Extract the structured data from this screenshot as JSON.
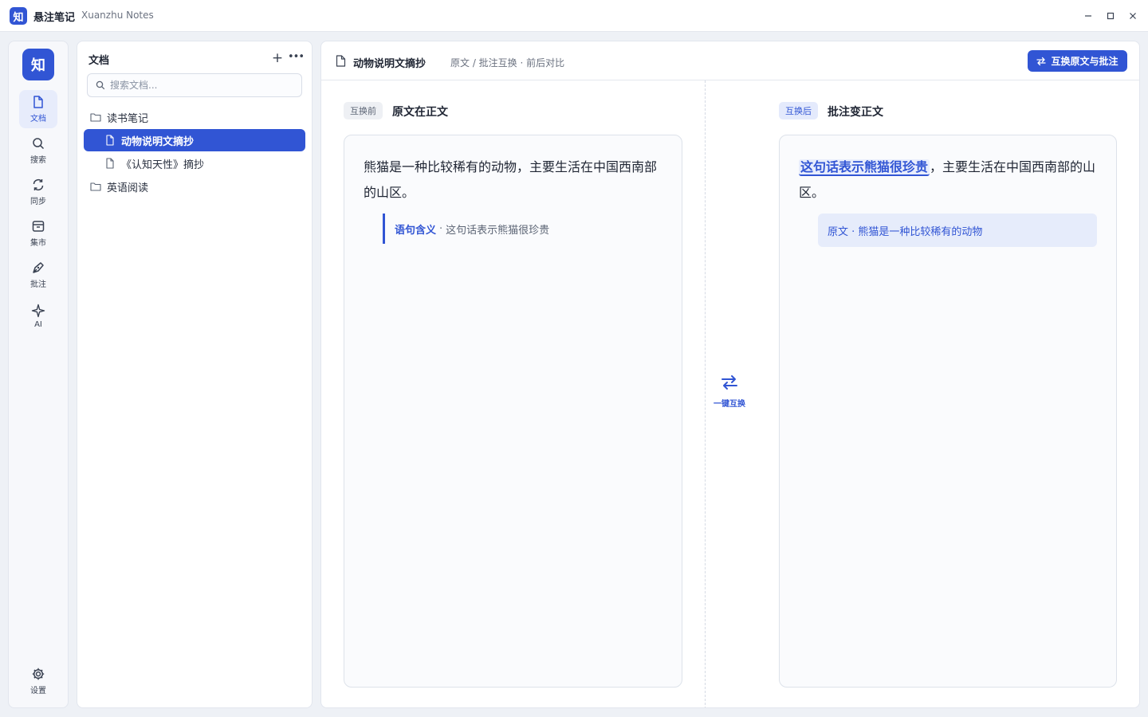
{
  "app": {
    "logo_char": "知",
    "name": "悬注笔记",
    "subtitle": "Xuanzhu Notes"
  },
  "window_controls": [
    "minimize-icon",
    "maximize-icon",
    "close-icon"
  ],
  "rail": {
    "logo_char": "知",
    "items": [
      {
        "label": "文档",
        "icon": "document-icon",
        "active": true
      },
      {
        "label": "搜索",
        "icon": "search-icon",
        "active": false
      },
      {
        "label": "同步",
        "icon": "sync-icon",
        "active": false
      },
      {
        "label": "集市",
        "icon": "market-icon",
        "active": false
      },
      {
        "label": "批注",
        "icon": "pen-icon",
        "active": false
      },
      {
        "label": "AI",
        "icon": "sparkle-icon",
        "active": false
      }
    ],
    "settings_label": "设置"
  },
  "doc_panel": {
    "title": "文档",
    "search_placeholder": "搜索文档...",
    "tree": [
      {
        "type": "folder",
        "label": "读书笔记"
      },
      {
        "type": "file",
        "label": "动物说明文摘抄",
        "active": true
      },
      {
        "type": "file",
        "label": "《认知天性》摘抄"
      },
      {
        "type": "folder",
        "label": "英语阅读"
      }
    ]
  },
  "main": {
    "doc_title": "动物说明文摘抄",
    "breadcrumb": "原文 / 批注互换 · 前后对比",
    "swap_button_label": "互换原文与批注",
    "before": {
      "tag": "互换前",
      "heading": "原文在正文",
      "text": "熊猫是一种比较稀有的动物，主要生活在中国西南部的山区。",
      "note_label": "语句含义",
      "note_sep": "·",
      "note_body": "这句话表示熊猫很珍贵"
    },
    "after": {
      "tag": "互换后",
      "heading": "批注变正文",
      "highlight": "这句话表示熊猫很珍贵",
      "text_rest": "，主要生活在中国西南部的山区。",
      "note": "原文 · 熊猫是一种比较稀有的动物"
    },
    "center_swap_label": "一键互换"
  },
  "colors": {
    "accent": "#3155d4",
    "accent_light": "#e6ecfb"
  }
}
